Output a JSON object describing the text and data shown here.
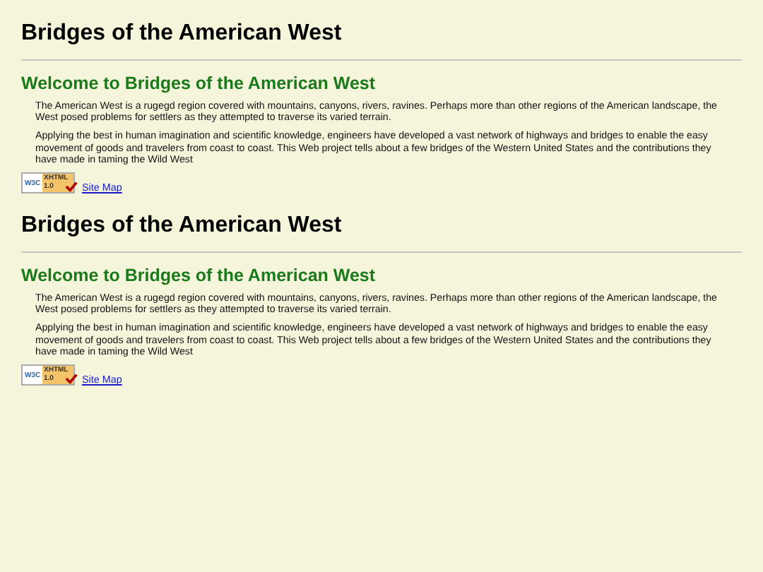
{
  "sections": [
    {
      "title": "Bridges of the American West",
      "heading": "Welcome to Bridges of the American West",
      "paragraphs": [
        "The American West is a rugegd region covered with mountains, canyons, rivers, ravines. Perhaps more than other regions of the American landscape, the West posed problems for settlers as they attempted to traverse its varied terrain.",
        "Applying the best in human imagination and scientific knowledge, engineers have developed a vast network of highways and bridges to enable the easy movement of goods and travelers from coast to coast. This Web project tells about a few bridges of the Western United States and the contributions they have made in taming the Wild West"
      ],
      "badge": {
        "left": "W3C",
        "right": "XHTML 1.0"
      },
      "link": "Site Map"
    },
    {
      "title": "Bridges of the American West",
      "heading": "Welcome to Bridges of the American West",
      "paragraphs": [
        "The American West is a rugegd region covered with mountains, canyons, rivers, ravines. Perhaps more than other regions of the American landscape, the West posed problems for settlers as they attempted to traverse its varied terrain.",
        "Applying the best in human imagination and scientific knowledge, engineers have developed a vast network of highways and bridges to enable the easy movement of goods and travelers from coast to coast. This Web project tells about a few bridges of the Western United States and the contributions they have made in taming the Wild West"
      ],
      "badge": {
        "left": "W3C",
        "right": "XHTML 1.0"
      },
      "link": "Site Map"
    }
  ]
}
